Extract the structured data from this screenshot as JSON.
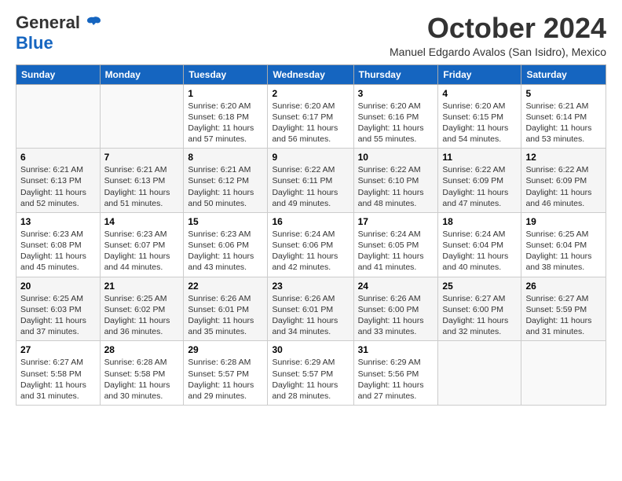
{
  "header": {
    "logo_general": "General",
    "logo_blue": "Blue",
    "month_title": "October 2024",
    "subtitle": "Manuel Edgardo Avalos (San Isidro), Mexico"
  },
  "days_of_week": [
    "Sunday",
    "Monday",
    "Tuesday",
    "Wednesday",
    "Thursday",
    "Friday",
    "Saturday"
  ],
  "weeks": [
    [
      {
        "day": "",
        "sunrise": "",
        "sunset": "",
        "daylight": ""
      },
      {
        "day": "",
        "sunrise": "",
        "sunset": "",
        "daylight": ""
      },
      {
        "day": "1",
        "sunrise": "Sunrise: 6:20 AM",
        "sunset": "Sunset: 6:18 PM",
        "daylight": "Daylight: 11 hours and 57 minutes."
      },
      {
        "day": "2",
        "sunrise": "Sunrise: 6:20 AM",
        "sunset": "Sunset: 6:17 PM",
        "daylight": "Daylight: 11 hours and 56 minutes."
      },
      {
        "day": "3",
        "sunrise": "Sunrise: 6:20 AM",
        "sunset": "Sunset: 6:16 PM",
        "daylight": "Daylight: 11 hours and 55 minutes."
      },
      {
        "day": "4",
        "sunrise": "Sunrise: 6:20 AM",
        "sunset": "Sunset: 6:15 PM",
        "daylight": "Daylight: 11 hours and 54 minutes."
      },
      {
        "day": "5",
        "sunrise": "Sunrise: 6:21 AM",
        "sunset": "Sunset: 6:14 PM",
        "daylight": "Daylight: 11 hours and 53 minutes."
      }
    ],
    [
      {
        "day": "6",
        "sunrise": "Sunrise: 6:21 AM",
        "sunset": "Sunset: 6:13 PM",
        "daylight": "Daylight: 11 hours and 52 minutes."
      },
      {
        "day": "7",
        "sunrise": "Sunrise: 6:21 AM",
        "sunset": "Sunset: 6:13 PM",
        "daylight": "Daylight: 11 hours and 51 minutes."
      },
      {
        "day": "8",
        "sunrise": "Sunrise: 6:21 AM",
        "sunset": "Sunset: 6:12 PM",
        "daylight": "Daylight: 11 hours and 50 minutes."
      },
      {
        "day": "9",
        "sunrise": "Sunrise: 6:22 AM",
        "sunset": "Sunset: 6:11 PM",
        "daylight": "Daylight: 11 hours and 49 minutes."
      },
      {
        "day": "10",
        "sunrise": "Sunrise: 6:22 AM",
        "sunset": "Sunset: 6:10 PM",
        "daylight": "Daylight: 11 hours and 48 minutes."
      },
      {
        "day": "11",
        "sunrise": "Sunrise: 6:22 AM",
        "sunset": "Sunset: 6:09 PM",
        "daylight": "Daylight: 11 hours and 47 minutes."
      },
      {
        "day": "12",
        "sunrise": "Sunrise: 6:22 AM",
        "sunset": "Sunset: 6:09 PM",
        "daylight": "Daylight: 11 hours and 46 minutes."
      }
    ],
    [
      {
        "day": "13",
        "sunrise": "Sunrise: 6:23 AM",
        "sunset": "Sunset: 6:08 PM",
        "daylight": "Daylight: 11 hours and 45 minutes."
      },
      {
        "day": "14",
        "sunrise": "Sunrise: 6:23 AM",
        "sunset": "Sunset: 6:07 PM",
        "daylight": "Daylight: 11 hours and 44 minutes."
      },
      {
        "day": "15",
        "sunrise": "Sunrise: 6:23 AM",
        "sunset": "Sunset: 6:06 PM",
        "daylight": "Daylight: 11 hours and 43 minutes."
      },
      {
        "day": "16",
        "sunrise": "Sunrise: 6:24 AM",
        "sunset": "Sunset: 6:06 PM",
        "daylight": "Daylight: 11 hours and 42 minutes."
      },
      {
        "day": "17",
        "sunrise": "Sunrise: 6:24 AM",
        "sunset": "Sunset: 6:05 PM",
        "daylight": "Daylight: 11 hours and 41 minutes."
      },
      {
        "day": "18",
        "sunrise": "Sunrise: 6:24 AM",
        "sunset": "Sunset: 6:04 PM",
        "daylight": "Daylight: 11 hours and 40 minutes."
      },
      {
        "day": "19",
        "sunrise": "Sunrise: 6:25 AM",
        "sunset": "Sunset: 6:04 PM",
        "daylight": "Daylight: 11 hours and 38 minutes."
      }
    ],
    [
      {
        "day": "20",
        "sunrise": "Sunrise: 6:25 AM",
        "sunset": "Sunset: 6:03 PM",
        "daylight": "Daylight: 11 hours and 37 minutes."
      },
      {
        "day": "21",
        "sunrise": "Sunrise: 6:25 AM",
        "sunset": "Sunset: 6:02 PM",
        "daylight": "Daylight: 11 hours and 36 minutes."
      },
      {
        "day": "22",
        "sunrise": "Sunrise: 6:26 AM",
        "sunset": "Sunset: 6:01 PM",
        "daylight": "Daylight: 11 hours and 35 minutes."
      },
      {
        "day": "23",
        "sunrise": "Sunrise: 6:26 AM",
        "sunset": "Sunset: 6:01 PM",
        "daylight": "Daylight: 11 hours and 34 minutes."
      },
      {
        "day": "24",
        "sunrise": "Sunrise: 6:26 AM",
        "sunset": "Sunset: 6:00 PM",
        "daylight": "Daylight: 11 hours and 33 minutes."
      },
      {
        "day": "25",
        "sunrise": "Sunrise: 6:27 AM",
        "sunset": "Sunset: 6:00 PM",
        "daylight": "Daylight: 11 hours and 32 minutes."
      },
      {
        "day": "26",
        "sunrise": "Sunrise: 6:27 AM",
        "sunset": "Sunset: 5:59 PM",
        "daylight": "Daylight: 11 hours and 31 minutes."
      }
    ],
    [
      {
        "day": "27",
        "sunrise": "Sunrise: 6:27 AM",
        "sunset": "Sunset: 5:58 PM",
        "daylight": "Daylight: 11 hours and 31 minutes."
      },
      {
        "day": "28",
        "sunrise": "Sunrise: 6:28 AM",
        "sunset": "Sunset: 5:58 PM",
        "daylight": "Daylight: 11 hours and 30 minutes."
      },
      {
        "day": "29",
        "sunrise": "Sunrise: 6:28 AM",
        "sunset": "Sunset: 5:57 PM",
        "daylight": "Daylight: 11 hours and 29 minutes."
      },
      {
        "day": "30",
        "sunrise": "Sunrise: 6:29 AM",
        "sunset": "Sunset: 5:57 PM",
        "daylight": "Daylight: 11 hours and 28 minutes."
      },
      {
        "day": "31",
        "sunrise": "Sunrise: 6:29 AM",
        "sunset": "Sunset: 5:56 PM",
        "daylight": "Daylight: 11 hours and 27 minutes."
      },
      {
        "day": "",
        "sunrise": "",
        "sunset": "",
        "daylight": ""
      },
      {
        "day": "",
        "sunrise": "",
        "sunset": "",
        "daylight": ""
      }
    ]
  ]
}
